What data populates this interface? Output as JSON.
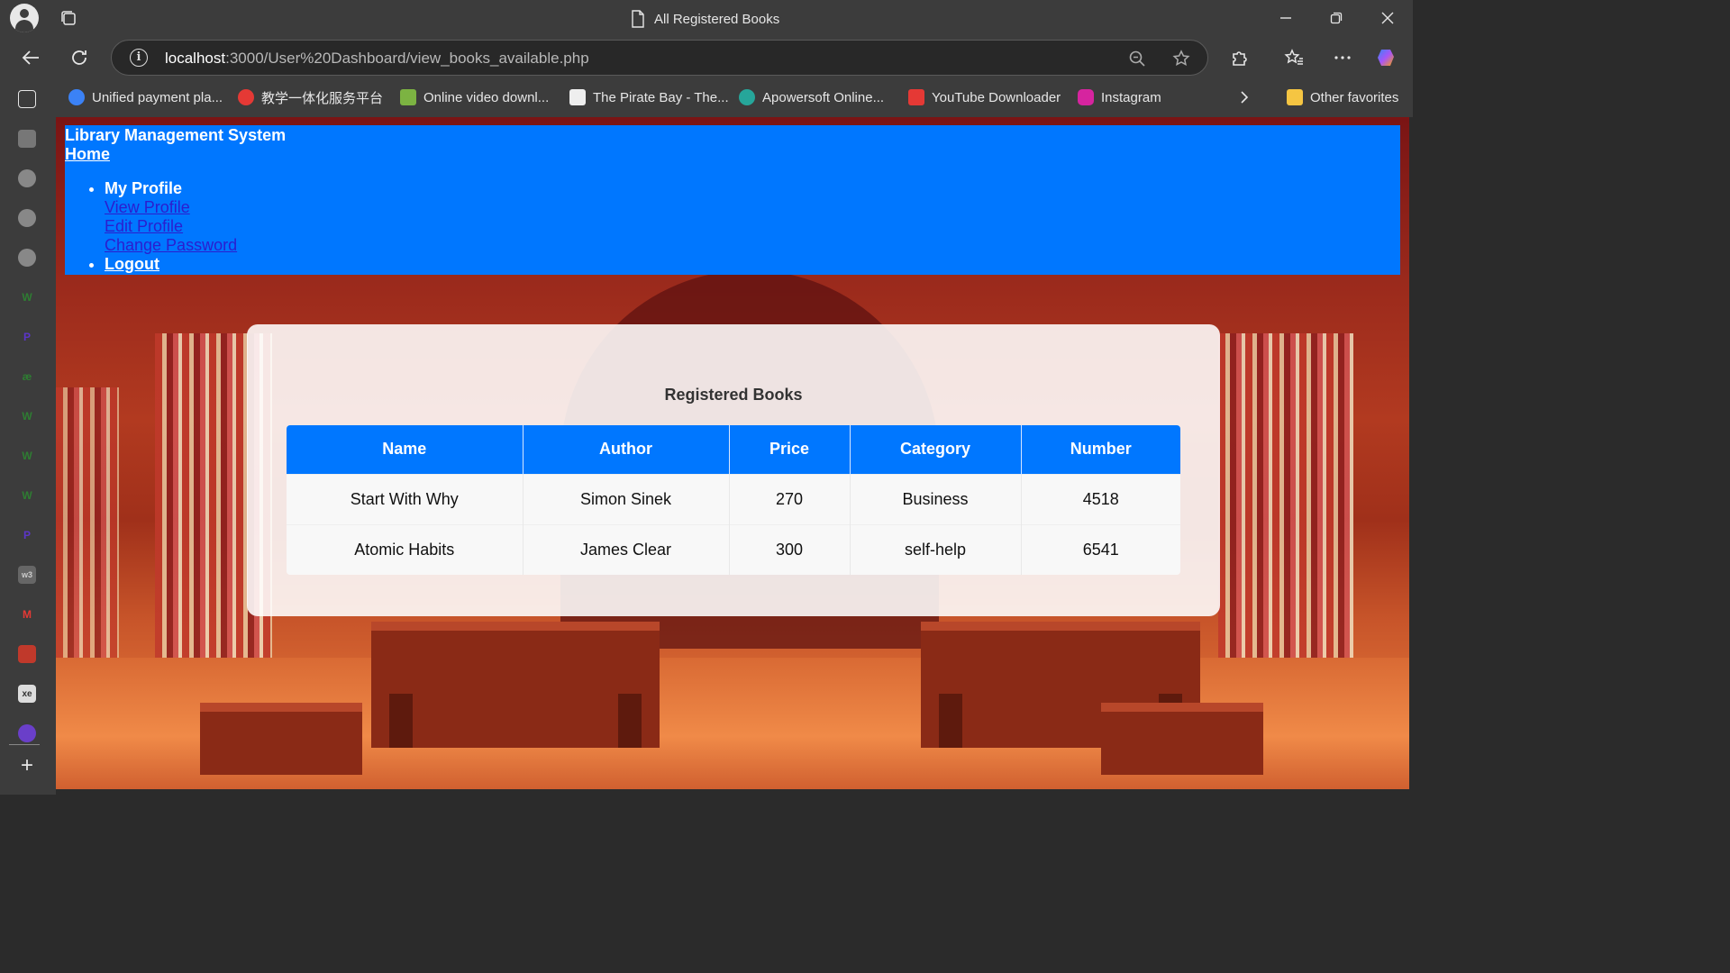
{
  "browser": {
    "tab_title": "All Registered Books",
    "url_host": "localhost",
    "url_path": ":3000/User%20Dashboard/view_books_available.php",
    "bookmarks": [
      {
        "label": "Unified payment pla...",
        "color": "#3b82f6"
      },
      {
        "label": "教学一体化服务平台",
        "color": "#e53935"
      },
      {
        "label": "Online video downl...",
        "color": "#7cb342"
      },
      {
        "label": "The Pirate Bay - The...",
        "color": "#eeeeee"
      },
      {
        "label": "Apowersoft Online...",
        "color": "#26a69a"
      },
      {
        "label": "YouTube Downloader",
        "color": "#e53935"
      },
      {
        "label": "Instagram",
        "color": "#d6249f"
      }
    ],
    "other_favorites": "Other favorites"
  },
  "site": {
    "brand": "Library Management System",
    "home": "Home",
    "nav": {
      "my_profile": "My Profile",
      "view_profile": "View Profile",
      "edit_profile": "Edit Profile",
      "change_password": "Change Password",
      "logout": "Logout"
    },
    "accent": "#0077ff"
  },
  "main": {
    "heading": "Registered Books",
    "columns": [
      "Name",
      "Author",
      "Price",
      "Category",
      "Number"
    ],
    "rows": [
      [
        "Start With Why",
        "Simon Sinek",
        "270",
        "Business",
        "4518"
      ],
      [
        "Atomic Habits",
        "James Clear",
        "300",
        "self-help",
        "6541"
      ]
    ]
  }
}
